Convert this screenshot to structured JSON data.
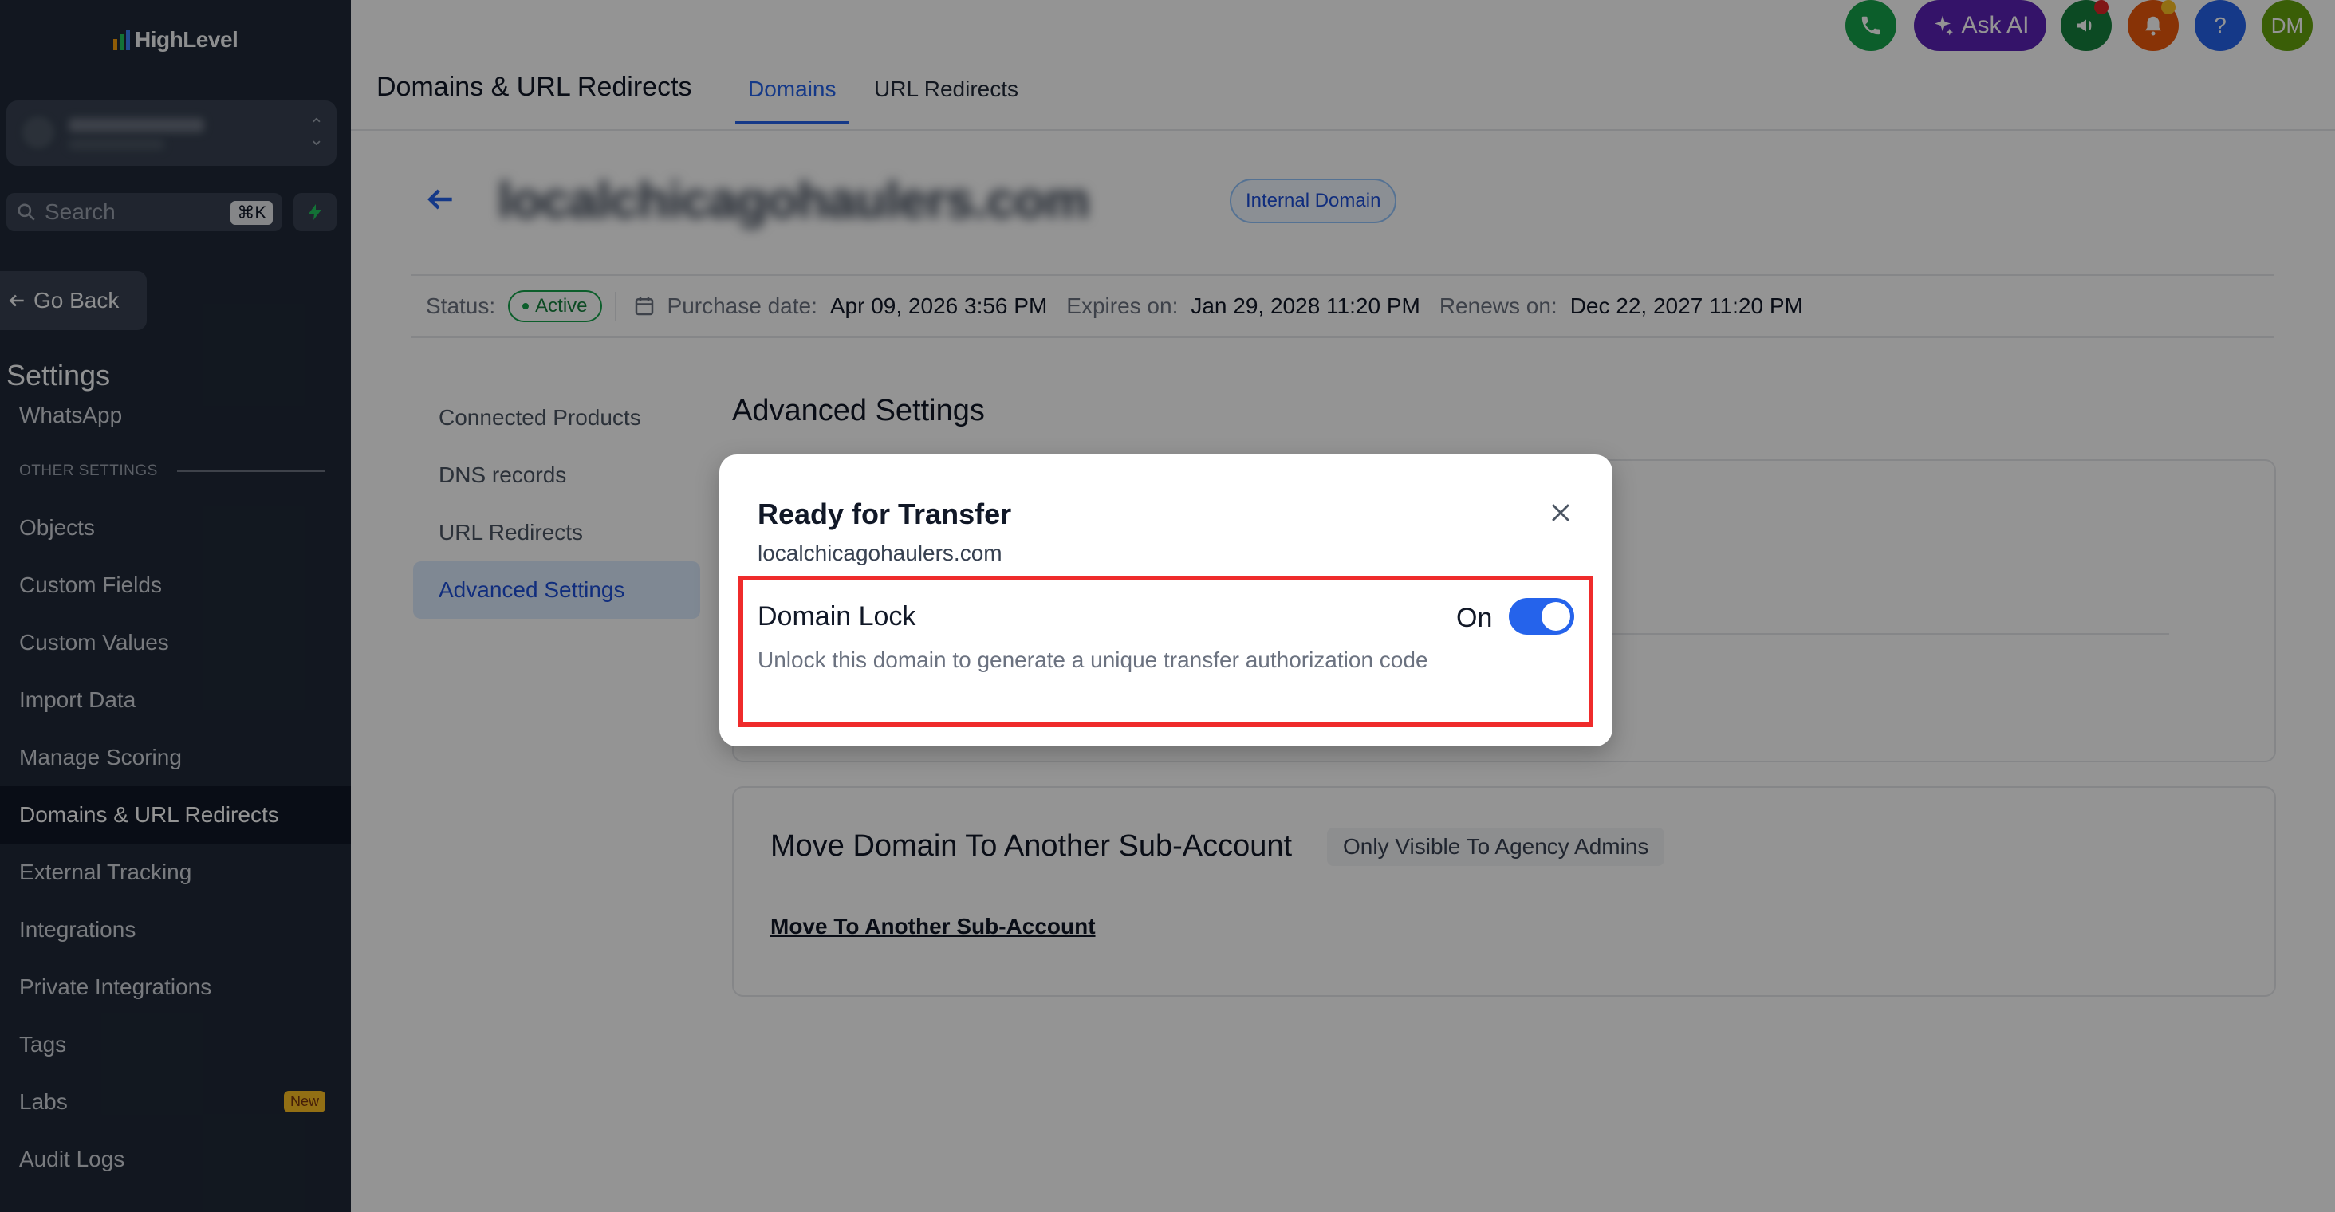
{
  "brand": {
    "logo_text": "HighLevel"
  },
  "sidebar": {
    "search_placeholder": "Search",
    "search_shortcut": "⌘K",
    "go_back": "Go Back",
    "settings_title": "Settings",
    "partial_item": "WhatsApp",
    "section_label": "OTHER SETTINGS",
    "items": [
      {
        "label": "Objects"
      },
      {
        "label": "Custom Fields"
      },
      {
        "label": "Custom Values"
      },
      {
        "label": "Import Data"
      },
      {
        "label": "Manage Scoring"
      },
      {
        "label": "Domains & URL Redirects",
        "active": true
      },
      {
        "label": "External Tracking"
      },
      {
        "label": "Integrations"
      },
      {
        "label": "Private Integrations"
      },
      {
        "label": "Tags"
      },
      {
        "label": "Labs",
        "badge": "New"
      },
      {
        "label": "Audit Logs"
      }
    ]
  },
  "header": {
    "title": "Domains & URL Redirects",
    "tabs": [
      {
        "label": "Domains",
        "active": true
      },
      {
        "label": "URL Redirects"
      }
    ],
    "ask_ai": "Ask AI",
    "help": "?",
    "avatar_initials": "DM"
  },
  "domain": {
    "name": "localchicagohaulers.com",
    "badge": "Internal Domain",
    "status_label": "Status:",
    "status_value": "Active",
    "purchase_label": "Purchase date:",
    "purchase_value": "Apr 09, 2026 3:56 PM",
    "expires_label": "Expires on:",
    "expires_value": "Jan 29, 2028 11:20 PM",
    "renews_label": "Renews on:",
    "renews_value": "Dec 22, 2027 11:20 PM"
  },
  "subnav": [
    {
      "label": "Connected Products"
    },
    {
      "label": "DNS records"
    },
    {
      "label": "URL Redirects"
    },
    {
      "label": "Advanced Settings",
      "active": true
    }
  ],
  "advanced": {
    "title": "Advanced Settings",
    "move_title": "Move Domain To Another Sub-Account",
    "move_badge": "Only Visible To Agency Admins",
    "move_link": "Move To Another Sub-Account"
  },
  "modal": {
    "title": "Ready for Transfer",
    "subtitle": "localchicagohaulers.com",
    "lock_title": "Domain Lock",
    "lock_desc": "Unlock this domain to generate a unique transfer authorization code",
    "lock_state": "On",
    "lock_enabled": true
  },
  "colors": {
    "accent": "#2563eb",
    "sidebar_bg": "#1f2937",
    "highlight": "#ef2b2b",
    "active_green": "#16a34a"
  }
}
